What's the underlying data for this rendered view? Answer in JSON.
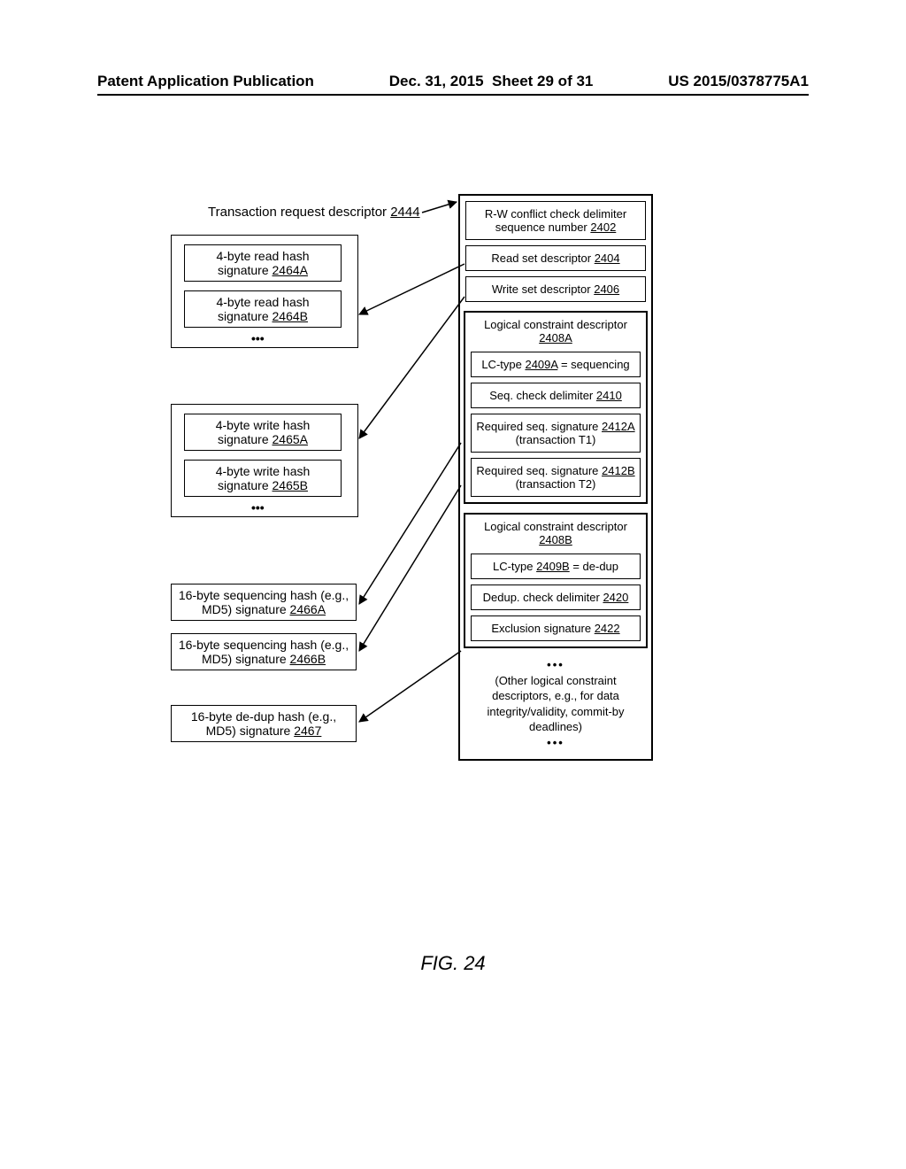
{
  "header": {
    "left": "Patent Application Publication",
    "center": "Dec. 31, 2015  Sheet 29 of 31",
    "right": "US 2015/0378775A1"
  },
  "figure_label": "FIG. 24",
  "title": {
    "text": "Transaction request descriptor",
    "ref": "2444"
  },
  "left": {
    "read_hash_a": {
      "line1": "4-byte read hash",
      "line2_pre": "signature ",
      "ref": "2464A"
    },
    "read_hash_b": {
      "line1": "4-byte read hash",
      "line2_pre": "signature ",
      "ref": "2464B"
    },
    "write_hash_a": {
      "line1": "4-byte write hash",
      "line2_pre": "signature ",
      "ref": "2465A"
    },
    "write_hash_b": {
      "line1": "4-byte write hash",
      "line2_pre": "signature ",
      "ref": "2465B"
    },
    "seq_hash_a": {
      "line1": "16-byte sequencing hash (e.g.,",
      "line2_pre": "MD5) signature ",
      "ref": "2466A"
    },
    "seq_hash_b": {
      "line1": "16-byte sequencing hash (e.g.,",
      "line2_pre": "MD5) signature ",
      "ref": "2466B"
    },
    "dedup_hash": {
      "line1": "16-byte de-dup hash (e.g.,",
      "line2_pre": "MD5) signature ",
      "ref": "2467"
    }
  },
  "right": {
    "rw_delim": {
      "line1": "R-W conflict check delimiter",
      "line2_pre": "sequence number ",
      "ref": "2402"
    },
    "read_set": {
      "text_pre": "Read set descriptor ",
      "ref": "2404"
    },
    "write_set": {
      "text_pre": "Write set descriptor ",
      "ref": "2406"
    },
    "lc_a": {
      "title_pre": "Logical constraint descriptor ",
      "ref": "2408A",
      "lctype_pre": "LC-type ",
      "lctype_ref": "2409A",
      "lctype_post": " = sequencing",
      "seq_delim_pre": "Seq. check delimiter ",
      "seq_delim_ref": "2410",
      "req_a_pre": "Required seq. signature ",
      "req_a_ref": "2412A",
      "req_a_post": "(transaction T1)",
      "req_b_pre": "Required seq. signature ",
      "req_b_ref": "2412B",
      "req_b_post": "(transaction T2)"
    },
    "lc_b": {
      "title_pre": "Logical constraint descriptor ",
      "ref": "2408B",
      "lctype_pre": "LC-type ",
      "lctype_ref": "2409B",
      "lctype_post": " = de-dup",
      "dedup_delim_pre": "Dedup. check delimiter ",
      "dedup_delim_ref": "2420",
      "excl_pre": "Exclusion signature ",
      "excl_ref": "2422"
    },
    "note": "(Other logical constraint descriptors, e.g., for data integrity/validity, commit-by deadlines)"
  },
  "ellipsis": "•••"
}
